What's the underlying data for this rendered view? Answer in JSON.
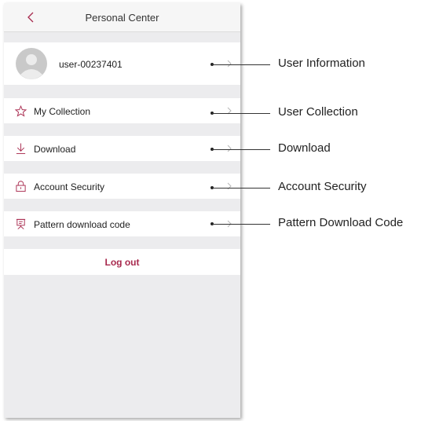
{
  "header": {
    "title": "Personal Center"
  },
  "profile": {
    "username": "user-00237401"
  },
  "menu": [
    {
      "label": "My Collection",
      "icon": "star-icon"
    },
    {
      "label": "Download",
      "icon": "download-icon"
    },
    {
      "label": "Account Security",
      "icon": "lock-icon"
    },
    {
      "label": "Pattern download code",
      "icon": "easel-icon"
    }
  ],
  "logout": {
    "label": "Log out",
    "color": "#a82a4e"
  },
  "annotations": [
    "User Information",
    "User Collection",
    "Download",
    "Account Security",
    "Pattern Download Code"
  ],
  "colors": {
    "accent": "#a82a4e",
    "background": "#ececee"
  }
}
